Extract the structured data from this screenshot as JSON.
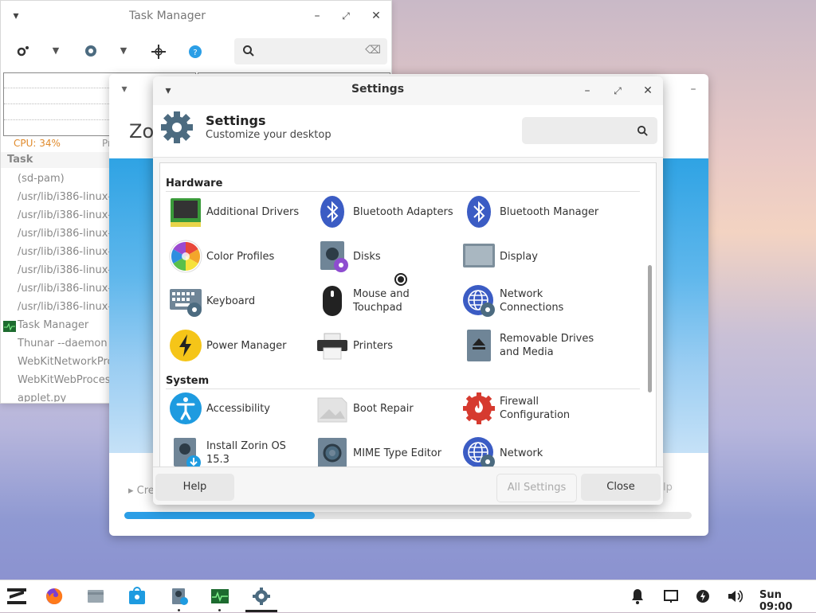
{
  "task_manager": {
    "title": "Task Manager",
    "cpu_label": "CPU: 34%",
    "pr_label": "Pr",
    "column_task": "Task",
    "processes": [
      "(sd-pam)",
      "/usr/lib/i386-linux-",
      "/usr/lib/i386-linux-",
      "/usr/lib/i386-linux-",
      "/usr/lib/i386-linux-",
      "/usr/lib/i386-linux-",
      "/usr/lib/i386-linux-",
      "/usr/lib/i386-linux-",
      "Task Manager",
      "Thunar --daemon",
      "WebKitNetworkPro",
      "WebKitWebProces",
      "applet.py"
    ]
  },
  "back_window": {
    "title_partial": "Zo",
    "expander_partial": "Cre",
    "help_partial": "lp",
    "progress_fraction": 0.335
  },
  "settings": {
    "window_title": "Settings",
    "header_title": "Settings",
    "header_subtitle": "Customize your desktop",
    "sections": {
      "hardware": "Hardware",
      "system": "System"
    },
    "items": {
      "additional_drivers": "Additional Drivers",
      "bluetooth_adapters": "Bluetooth Adapters",
      "bluetooth_manager": "Bluetooth Manager",
      "color_profiles": "Color Profiles",
      "disks": "Disks",
      "display": "Display",
      "keyboard": "Keyboard",
      "mouse_line1": "Mouse and",
      "mouse_line2": "Touchpad",
      "network_conn_line1": "Network",
      "network_conn_line2": "Connections",
      "power_manager": "Power Manager",
      "printers": "Printers",
      "removable_line1": "Removable Drives",
      "removable_line2": "and Media",
      "accessibility": "Accessibility",
      "boot_repair": "Boot Repair",
      "firewall_line1": "Firewall",
      "firewall_line2": "Configuration",
      "install_zorin": "Install Zorin OS 15.3",
      "mime_editor": "MIME Type Editor",
      "network": "Network"
    },
    "buttons": {
      "help": "Help",
      "all_settings": "All Settings",
      "close": "Close"
    }
  },
  "taskbar": {
    "clock": "Sun 09:00",
    "apps": [
      "zorin-menu-icon",
      "firefox-icon",
      "files-icon",
      "software-icon",
      "installer-icon",
      "task-manager-icon",
      "settings-icon"
    ]
  },
  "colors": {
    "accent": "#2b9ee6",
    "cpu": "#e08a2b"
  }
}
